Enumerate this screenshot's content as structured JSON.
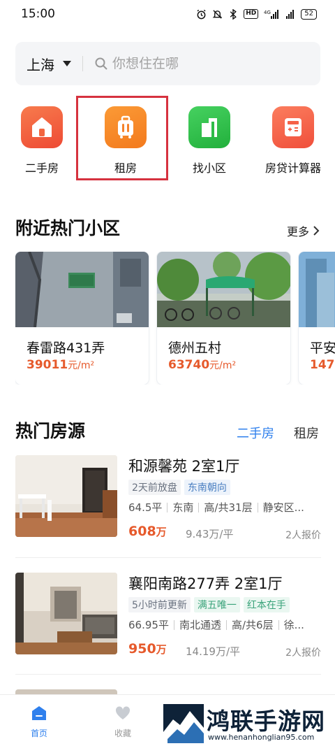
{
  "status_bar": {
    "time": "15:00",
    "network": "4G",
    "battery": "52"
  },
  "search": {
    "city": "上海",
    "placeholder": "你想住在哪"
  },
  "quick_nav": [
    {
      "label": "二手房",
      "icon": "house-icon",
      "color": "#f05a3c"
    },
    {
      "label": "租房",
      "icon": "suitcase-icon",
      "color": "#f6822a"
    },
    {
      "label": "找小区",
      "icon": "building-icon",
      "color": "#31c04a"
    },
    {
      "label": "房贷计算器",
      "icon": "calculator-icon",
      "color": "#f56248"
    }
  ],
  "nearby": {
    "title": "附近热门小区",
    "more": "更多",
    "cards": [
      {
        "name": "春雷路431弄",
        "price": "39011",
        "unit": "元/m²"
      },
      {
        "name": "德州五村",
        "price": "63740",
        "unit": "元/m²"
      },
      {
        "name": "平安",
        "price": "147",
        "unit": ""
      }
    ]
  },
  "hot": {
    "title": "热门房源",
    "tabs": [
      {
        "label": "二手房",
        "active": true
      },
      {
        "label": "租房",
        "active": false
      }
    ],
    "listings": [
      {
        "title": "和源馨苑 2室1厅",
        "tags": [
          "2天前放盘",
          "东南朝向"
        ],
        "attrs": [
          "64.5平",
          "东南",
          "高/共31层",
          "静安区..."
        ],
        "price": "608",
        "price_unit": "万",
        "unit_price": "9.43万/平",
        "quotes": "2人报价"
      },
      {
        "title": "襄阳南路277弄 2室1厅",
        "tags": [
          "5小时前更新",
          "满五唯一",
          "红本在手"
        ],
        "attrs": [
          "66.95平",
          "南北通透",
          "高/共6层",
          "徐..."
        ],
        "price": "950",
        "price_unit": "万",
        "unit_price": "14.19万/平",
        "quotes": "2人报价"
      }
    ]
  },
  "bottom_nav": [
    {
      "label": "首页",
      "active": true
    },
    {
      "label": "收藏",
      "active": false
    }
  ],
  "watermark": {
    "title": "鸿联手游网",
    "url": "www.henanhonglian95.com"
  },
  "colors": {
    "accent": "#2f80ed",
    "price": "#e65a2c",
    "highlight": "#d6323f"
  }
}
